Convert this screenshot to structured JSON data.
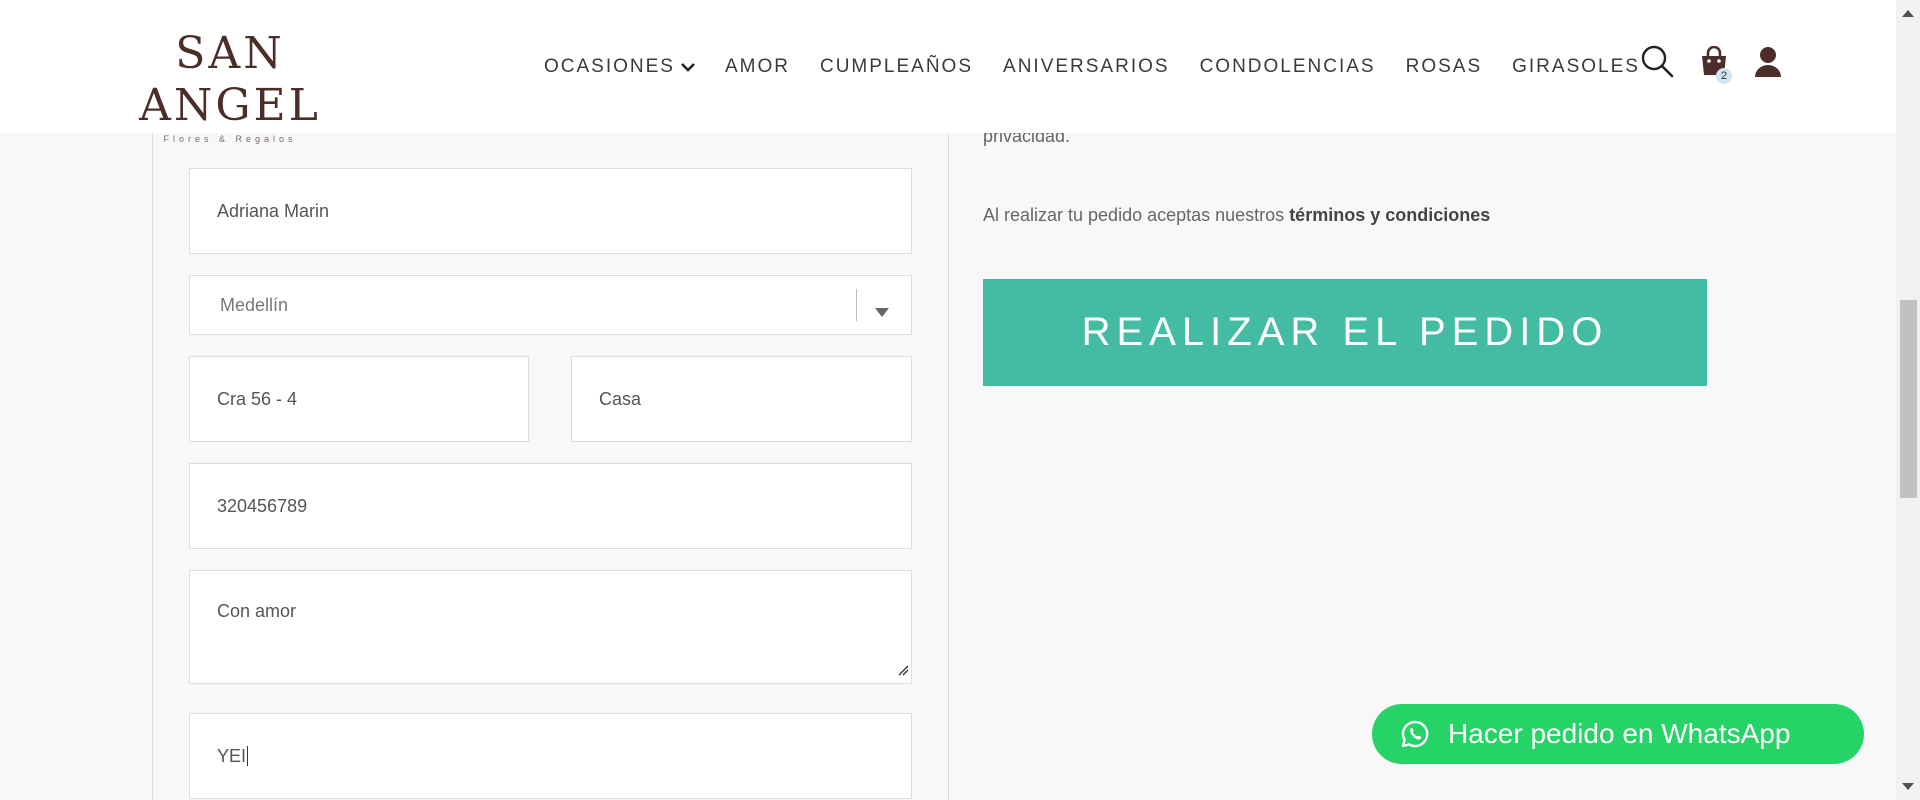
{
  "header": {
    "logo_title": "SAN ANGEL",
    "logo_subtitle": "Flores & Regalos",
    "nav": [
      {
        "label": "OCASIONES",
        "has_dropdown": true
      },
      {
        "label": "AMOR"
      },
      {
        "label": "CUMPLEAÑOS"
      },
      {
        "label": "ANIVERSARIOS"
      },
      {
        "label": "CONDOLENCIAS"
      },
      {
        "label": "ROSAS"
      },
      {
        "label": "GIRASOLES"
      }
    ],
    "icons": [
      "search-icon",
      "cart-icon",
      "user-icon"
    ],
    "cart_count": "2"
  },
  "form": {
    "name_value": "Adriana Marin",
    "city_value": "Medellín",
    "address_value": "Cra 56 - 4",
    "address_extra_value": "Casa",
    "phone_value": "320456789",
    "message_value": "Con amor",
    "signature_value": "YEI"
  },
  "summary": {
    "privacy_text": "privacidad.",
    "terms_prefix": "Al realizar tu pedido aceptas nuestros ",
    "terms_link": "términos y condiciones",
    "order_button": "REALIZAR EL PEDIDO"
  },
  "whatsapp": {
    "label": "Hacer pedido en WhatsApp"
  },
  "colors": {
    "brand": "#4b2e2a",
    "accent": "#43bca3",
    "whatsapp": "#25d366",
    "background": "#f8f8f8"
  }
}
